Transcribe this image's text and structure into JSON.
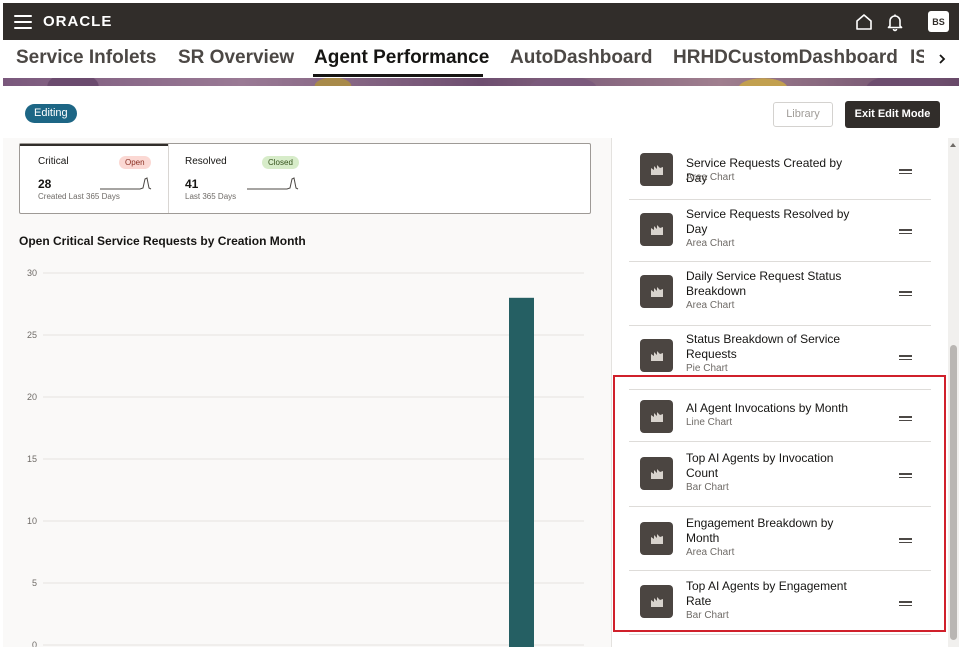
{
  "header": {
    "brand": "ORACLE",
    "avatar_initials": "BS",
    "icons": [
      "hamburger-menu-icon",
      "home-icon",
      "bell-icon"
    ]
  },
  "tabs": [
    {
      "label": "Service Infolets",
      "active": false
    },
    {
      "label": "SR Overview",
      "active": false
    },
    {
      "label": "Agent Performance",
      "active": true
    },
    {
      "label": "AutoDashboard",
      "active": false
    },
    {
      "label": "HRHDCustomDashboard",
      "active": false
    },
    {
      "label": "IS",
      "active": false
    }
  ],
  "toolbar": {
    "editing_label": "Editing",
    "library_label": "Library",
    "exit_label": "Exit Edit Mode"
  },
  "infolets": [
    {
      "label": "Critical",
      "badge": "Open",
      "value": "28",
      "sub": "Created Last 365 Days"
    },
    {
      "label": "Resolved",
      "badge": "Closed",
      "value": "41",
      "sub": "Last 365 Days"
    }
  ],
  "chart_data": {
    "type": "bar",
    "title": "Open Critical Service Requests by Creation Month",
    "yticks": [
      "30",
      "25",
      "20",
      "15",
      "10",
      "5",
      "0"
    ],
    "ylim": [
      0,
      30
    ],
    "values": [
      28
    ],
    "bar_color": "#255f63",
    "grid": true
  },
  "library_items": [
    {
      "title": "Service Requests Created by Day",
      "type": "Area Chart"
    },
    {
      "title": "Service Requests Resolved by Day",
      "type": "Area Chart"
    },
    {
      "title": "Daily Service Request Status Breakdown",
      "type": "Area Chart"
    },
    {
      "title": "Status Breakdown of Service Requests",
      "type": "Pie Chart"
    },
    {
      "title": "AI Agent Invocations by Month",
      "type": "Line Chart"
    },
    {
      "title": "Top AI Agents by Invocation Count",
      "type": "Bar Chart"
    },
    {
      "title": "Engagement Breakdown by Month",
      "type": "Area Chart"
    },
    {
      "title": "Top AI Agents by Engagement Rate",
      "type": "Bar Chart"
    }
  ],
  "colors": {
    "header_bg": "#312d2a",
    "editing_badge": "#1d6685",
    "highlight": "#d0202b"
  }
}
